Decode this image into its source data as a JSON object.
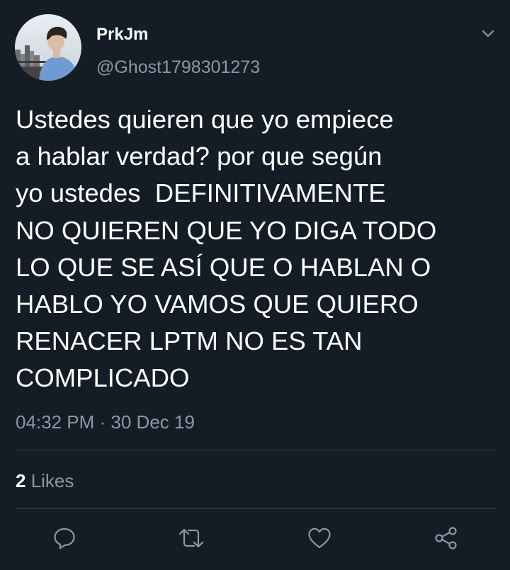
{
  "user": {
    "display_name": "PrkJm",
    "handle": "@Ghost1798301273"
  },
  "tweet": {
    "text": "Ustedes quieren que yo empiece\na hablar verdad? por que según\nyo ustedes  DEFINITIVAMENTE\nNO QUIEREN QUE YO DIGA TODO\nLO QUE SE ASÍ QUE O HABLAN O\nHABLO YO VAMOS QUE QUIERO\nRENACER LPTM NO ES TAN\nCOMPLICADO",
    "timestamp": "04:32 PM · 30 Dec 19"
  },
  "stats": {
    "likes_count": "2",
    "likes_label": " Likes"
  },
  "icons": {
    "menu": "chevron-down-icon",
    "reply": "reply-icon",
    "retweet": "retweet-icon",
    "like": "heart-icon",
    "share": "share-icon"
  },
  "colors": {
    "background": "#141d26",
    "text": "#ffffff",
    "secondary_text": "#8899a6",
    "divider": "#38444d"
  }
}
